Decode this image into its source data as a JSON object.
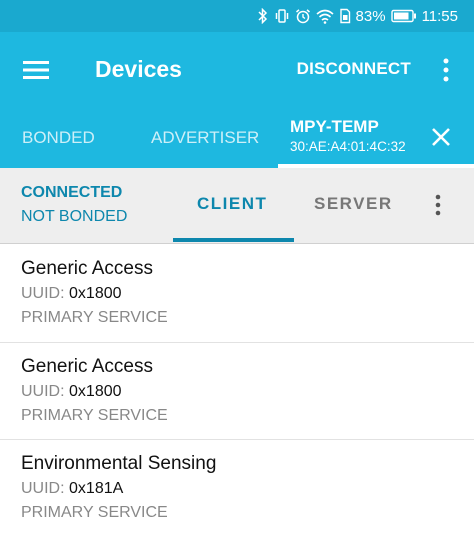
{
  "status_bar": {
    "battery": "83%",
    "time": "11:55"
  },
  "app_bar": {
    "title": "Devices",
    "disconnect_label": "DISCONNECT"
  },
  "device_tabs": {
    "bonded": "BONDED",
    "advertiser": "ADVERTISER",
    "device_name": "MPY-TEMP",
    "device_address": "30:AE:A4:01:4C:32"
  },
  "connection": {
    "state": "CONNECTED",
    "bond_state": "NOT BONDED",
    "tabs": [
      "CLIENT",
      "SERVER"
    ]
  },
  "services": [
    {
      "name": "Generic Access",
      "uuid_label": "UUID:",
      "uuid": "0x1800",
      "type": "PRIMARY SERVICE"
    },
    {
      "name": "Generic Access",
      "uuid_label": "UUID:",
      "uuid": "0x1800",
      "type": "PRIMARY SERVICE"
    },
    {
      "name": "Environmental Sensing",
      "uuid_label": "UUID:",
      "uuid": "0x181A",
      "type": "PRIMARY SERVICE"
    }
  ],
  "colors": {
    "primary": "#1eb8e0",
    "primary_dark": "#1aa9cf",
    "accent": "#0d87ad"
  }
}
